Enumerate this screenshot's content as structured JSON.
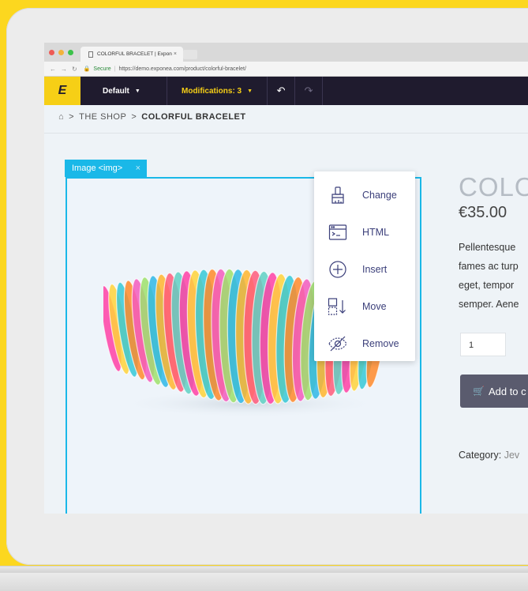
{
  "browser": {
    "tab_title": "COLORFUL BRACELET | Expon",
    "tab_close": "×",
    "secure_label": "Secure",
    "url": "https://demo.exponea.com/product/colorful-bracelet/",
    "traffic_colors": [
      "#ee5b55",
      "#f2b23b",
      "#3cc24a"
    ]
  },
  "toolbar": {
    "logo": "E",
    "variant_label": "Default",
    "modifications_label": "Modifications: 3",
    "accent": "#f6cf16",
    "background": "#1f1b2e"
  },
  "breadcrumb": {
    "separator": ">",
    "shop": "THE SHOP",
    "current": "COLORFUL BRACELET"
  },
  "editor": {
    "element_label": "Image <img>",
    "element_close": "×",
    "highlight": "#1ab8e8",
    "menu": [
      {
        "label": "Change",
        "icon": "paint-brush-icon"
      },
      {
        "label": "HTML",
        "icon": "code-window-icon"
      },
      {
        "label": "Insert",
        "icon": "plus-circle-icon"
      },
      {
        "label": "Move",
        "icon": "move-down-icon"
      },
      {
        "label": "Remove",
        "icon": "eye-slash-icon"
      }
    ]
  },
  "product": {
    "title": "COLO",
    "price": "€35.00",
    "description_lines": [
      "Pellentesque",
      "fames ac turp",
      "eget, tempor",
      "semper. Aene"
    ],
    "quantity": "1",
    "add_to_cart": "Add to c",
    "category_label": "Category:",
    "category_value": "Jev"
  }
}
